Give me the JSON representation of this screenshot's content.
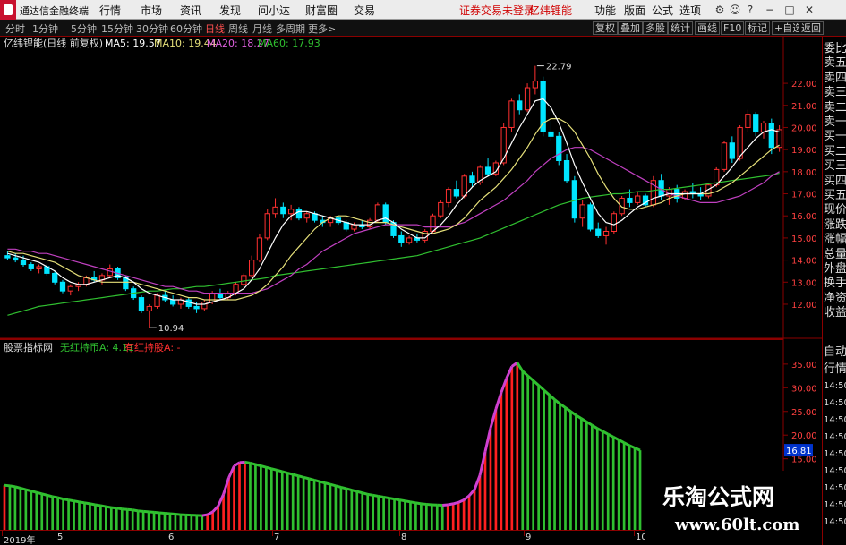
{
  "menubar": {
    "title": "通达信金融终端",
    "menu": [
      "行情",
      "市场",
      "资讯",
      "发现",
      "问小达",
      "财富圈",
      "交易"
    ],
    "notice": "证券交易未登录",
    "indicator_name": "亿纬锂能",
    "right": [
      "功能",
      "版面",
      "公式",
      "选项"
    ]
  },
  "periodbar": {
    "periods": [
      "分时",
      "1分钟",
      "5分钟",
      "15分钟",
      "30分钟",
      "60分钟",
      "日线",
      "周线",
      "月线",
      "多周期",
      "更多>"
    ],
    "active": "日线",
    "tools": [
      "复权",
      "叠加",
      "多股",
      "统计",
      "画线",
      "F10",
      "标记",
      "+自选",
      "返回"
    ]
  },
  "main_chart": {
    "title": "亿纬锂能(日线 前复权)",
    "ma5": "MA5: 19.57",
    "ma10": "MA10: 19.44",
    "ma20": "MA20: 18.27",
    "ma60": "MA60: 17.93",
    "high_label": "22.79",
    "low_label": "10.94",
    "y_labels": [
      "22.00",
      "21.00",
      "20.00",
      "19.00",
      "18.00",
      "17.00",
      "16.00",
      "15.00",
      "14.00",
      "13.00",
      "12.00"
    ]
  },
  "sub_chart": {
    "title": "股票指标网",
    "line1": "无红持币A: 4.11",
    "line2": "有红持股A: -",
    "y_labels": [
      "35.00",
      "30.00",
      "25.00",
      "20.00",
      "15.00"
    ],
    "current_value": "16.81"
  },
  "right_panel": {
    "items": [
      "委比",
      "卖五",
      "卖四",
      "卖三",
      "卖二",
      "卖一",
      "买一",
      "买二",
      "买三",
      "买四",
      "买五",
      "现价",
      "涨跌",
      "涨幅",
      "总量",
      "外盘",
      "换手",
      "净资",
      "收益"
    ],
    "sub_items": [
      "自动",
      "行情",
      "14:50",
      "14:50",
      "14:50",
      "14:50",
      "14:50",
      "14:50",
      "14:50",
      "14:50",
      "14:50"
    ]
  },
  "time_axis": {
    "labels": [
      "2019年",
      "5",
      "6",
      "7",
      "8",
      "9",
      "10"
    ]
  },
  "watermark": {
    "line1": "乐淘公式网",
    "line2": "www.60lt.com"
  },
  "colors": {
    "up": "#ff3030",
    "down": "#00e5ff",
    "ma5": "#ffffff",
    "ma10": "#e6e07a",
    "ma20": "#c040c0",
    "ma60": "#30c030",
    "grid_red": "#8b0000",
    "bar_green": "#30c030",
    "bar_red": "#ff2020",
    "bar_magenta": "#d040d0"
  },
  "chart_data": {
    "type": "candlestick",
    "ohlc": [
      [
        14.2,
        14.4,
        14.0,
        14.1
      ],
      [
        14.1,
        14.3,
        13.9,
        14.0
      ],
      [
        14.0,
        14.2,
        13.7,
        13.8
      ],
      [
        13.8,
        13.9,
        13.5,
        13.6
      ],
      [
        13.6,
        13.8,
        13.4,
        13.7
      ],
      [
        13.7,
        13.8,
        13.3,
        13.4
      ],
      [
        13.4,
        13.5,
        12.9,
        13.0
      ],
      [
        13.0,
        13.1,
        12.5,
        12.6
      ],
      [
        12.6,
        12.9,
        12.4,
        12.8
      ],
      [
        12.8,
        13.0,
        12.6,
        12.9
      ],
      [
        12.9,
        13.3,
        12.8,
        13.2
      ],
      [
        13.2,
        13.5,
        13.0,
        13.1
      ],
      [
        13.1,
        13.4,
        12.9,
        13.3
      ],
      [
        13.3,
        13.8,
        13.2,
        13.6
      ],
      [
        13.6,
        13.7,
        13.1,
        13.2
      ],
      [
        13.2,
        13.3,
        12.6,
        12.7
      ],
      [
        12.7,
        12.8,
        12.2,
        12.3
      ],
      [
        12.3,
        12.4,
        11.6,
        11.7
      ],
      [
        11.7,
        12.0,
        10.94,
        11.9
      ],
      [
        11.9,
        12.5,
        11.8,
        12.4
      ],
      [
        12.4,
        12.6,
        12.1,
        12.2
      ],
      [
        12.2,
        12.4,
        11.9,
        12.0
      ],
      [
        12.0,
        12.3,
        11.8,
        12.2
      ],
      [
        12.2,
        12.3,
        11.8,
        11.9
      ],
      [
        11.9,
        12.1,
        11.6,
        11.8
      ],
      [
        11.8,
        12.2,
        11.7,
        12.1
      ],
      [
        12.1,
        12.6,
        12.0,
        12.5
      ],
      [
        12.5,
        12.7,
        12.2,
        12.3
      ],
      [
        12.3,
        12.6,
        12.2,
        12.5
      ],
      [
        12.5,
        13.0,
        12.4,
        12.9
      ],
      [
        12.9,
        13.4,
        12.8,
        13.3
      ],
      [
        13.3,
        14.2,
        13.2,
        14.0
      ],
      [
        14.0,
        15.2,
        13.9,
        15.0
      ],
      [
        15.0,
        16.3,
        14.9,
        16.1
      ],
      [
        16.1,
        16.8,
        15.9,
        16.4
      ],
      [
        16.4,
        16.6,
        15.9,
        16.1
      ],
      [
        16.1,
        16.5,
        15.8,
        16.3
      ],
      [
        16.3,
        16.4,
        15.8,
        15.9
      ],
      [
        15.9,
        16.2,
        15.7,
        16.1
      ],
      [
        16.1,
        16.2,
        15.7,
        15.8
      ],
      [
        15.8,
        16.0,
        15.5,
        15.7
      ],
      [
        15.7,
        16.0,
        15.5,
        15.9
      ],
      [
        15.9,
        16.0,
        15.6,
        15.7
      ],
      [
        15.7,
        15.8,
        15.3,
        15.4
      ],
      [
        15.4,
        15.7,
        15.3,
        15.6
      ],
      [
        15.6,
        15.8,
        15.4,
        15.5
      ],
      [
        15.5,
        15.9,
        15.4,
        15.8
      ],
      [
        15.8,
        16.6,
        15.7,
        16.5
      ],
      [
        16.5,
        16.6,
        15.6,
        15.7
      ],
      [
        15.7,
        15.8,
        15.0,
        15.1
      ],
      [
        15.1,
        15.3,
        14.6,
        14.8
      ],
      [
        14.8,
        15.1,
        14.7,
        15.0
      ],
      [
        15.0,
        15.2,
        14.8,
        14.9
      ],
      [
        14.9,
        15.4,
        14.8,
        15.3
      ],
      [
        15.3,
        16.1,
        15.2,
        16.0
      ],
      [
        16.0,
        16.7,
        15.9,
        16.6
      ],
      [
        16.6,
        17.3,
        16.4,
        17.2
      ],
      [
        17.2,
        17.6,
        16.8,
        16.9
      ],
      [
        16.9,
        17.9,
        16.8,
        17.8
      ],
      [
        17.8,
        18.0,
        17.3,
        17.5
      ],
      [
        17.5,
        18.3,
        17.4,
        18.2
      ],
      [
        18.2,
        18.6,
        17.8,
        17.9
      ],
      [
        17.9,
        18.5,
        17.8,
        18.4
      ],
      [
        18.4,
        20.2,
        18.3,
        20.0
      ],
      [
        20.0,
        21.3,
        19.8,
        21.2
      ],
      [
        21.2,
        21.5,
        20.6,
        20.8
      ],
      [
        20.8,
        22.0,
        20.7,
        21.8
      ],
      [
        21.8,
        22.79,
        21.5,
        22.1
      ],
      [
        22.1,
        22.3,
        19.6,
        19.8
      ],
      [
        19.8,
        20.3,
        19.4,
        19.6
      ],
      [
        19.6,
        19.8,
        18.3,
        18.5
      ],
      [
        18.5,
        18.8,
        17.5,
        17.6
      ],
      [
        17.6,
        17.8,
        15.7,
        15.9
      ],
      [
        15.9,
        16.7,
        15.5,
        16.5
      ],
      [
        16.5,
        16.6,
        15.3,
        15.4
      ],
      [
        15.4,
        15.7,
        15.0,
        15.1
      ],
      [
        15.1,
        15.5,
        14.7,
        15.3
      ],
      [
        15.3,
        16.2,
        15.2,
        16.1
      ],
      [
        16.1,
        16.9,
        16.0,
        16.8
      ],
      [
        16.8,
        17.2,
        16.4,
        16.6
      ],
      [
        16.6,
        17.1,
        16.5,
        16.9
      ],
      [
        16.9,
        17.0,
        16.4,
        16.5
      ],
      [
        16.5,
        17.8,
        16.4,
        17.6
      ],
      [
        17.6,
        17.9,
        16.7,
        16.9
      ],
      [
        16.9,
        17.3,
        16.5,
        17.2
      ],
      [
        17.2,
        17.4,
        16.6,
        16.8
      ],
      [
        16.8,
        17.2,
        16.7,
        17.1
      ],
      [
        17.1,
        17.5,
        16.8,
        17.0
      ],
      [
        17.0,
        17.3,
        16.7,
        16.9
      ],
      [
        16.9,
        17.5,
        16.8,
        17.4
      ],
      [
        17.4,
        18.2,
        17.3,
        18.1
      ],
      [
        18.1,
        19.4,
        18.0,
        19.3
      ],
      [
        19.3,
        19.6,
        18.4,
        18.6
      ],
      [
        18.6,
        20.1,
        18.5,
        20.0
      ],
      [
        20.0,
        20.8,
        19.8,
        20.6
      ],
      [
        20.6,
        20.7,
        19.6,
        19.8
      ],
      [
        19.8,
        20.3,
        19.5,
        20.2
      ],
      [
        20.2,
        20.4,
        18.8,
        19.1
      ],
      [
        19.1,
        20.1,
        18.9,
        19.9
      ]
    ],
    "ma5": [
      14.3,
      14.2,
      14.1,
      14.0,
      13.9,
      13.7,
      13.5,
      13.2,
      13.0,
      12.9,
      12.9,
      13.0,
      13.1,
      13.2,
      13.3,
      13.2,
      13.0,
      12.7,
      12.5,
      12.4,
      12.3,
      12.2,
      12.2,
      12.1,
      12.0,
      12.0,
      12.1,
      12.2,
      12.3,
      12.5,
      12.7,
      13.1,
      13.6,
      14.3,
      15.0,
      15.6,
      16.0,
      16.2,
      16.2,
      16.1,
      16.0,
      15.9,
      15.8,
      15.7,
      15.6,
      15.6,
      15.6,
      15.8,
      15.9,
      15.7,
      15.4,
      15.2,
      15.0,
      15.0,
      15.3,
      15.6,
      16.0,
      16.5,
      16.9,
      17.3,
      17.6,
      17.8,
      18.0,
      18.6,
      19.3,
      20.0,
      20.6,
      21.2,
      21.3,
      20.9,
      20.2,
      19.3,
      18.3,
      17.5,
      16.8,
      16.1,
      15.7,
      15.6,
      15.8,
      16.1,
      16.4,
      16.6,
      16.8,
      16.9,
      17.0,
      17.0,
      17.0,
      17.0,
      17.0,
      17.2,
      17.4,
      17.8,
      18.2,
      18.7,
      19.1,
      19.5,
      19.8,
      19.9,
      19.8
    ],
    "ma10": [
      14.4,
      14.3,
      14.3,
      14.2,
      14.1,
      14.0,
      13.9,
      13.7,
      13.5,
      13.3,
      13.2,
      13.1,
      13.0,
      13.0,
      13.0,
      13.0,
      13.0,
      12.9,
      12.8,
      12.7,
      12.6,
      12.5,
      12.4,
      12.3,
      12.3,
      12.2,
      12.2,
      12.2,
      12.2,
      12.2,
      12.3,
      12.4,
      12.6,
      12.9,
      13.3,
      13.7,
      14.2,
      14.6,
      15.0,
      15.4,
      15.7,
      15.9,
      16.0,
      16.0,
      15.9,
      15.8,
      15.7,
      15.7,
      15.7,
      15.6,
      15.5,
      15.4,
      15.3,
      15.2,
      15.2,
      15.3,
      15.4,
      15.6,
      15.9,
      16.3,
      16.7,
      17.0,
      17.3,
      17.7,
      18.1,
      18.6,
      19.1,
      19.7,
      20.2,
      20.4,
      20.4,
      20.2,
      19.8,
      19.2,
      18.6,
      17.9,
      17.3,
      16.8,
      16.4,
      16.3,
      16.3,
      16.4,
      16.5,
      16.6,
      16.8,
      16.9,
      17.0,
      17.0,
      17.0,
      17.0,
      17.1,
      17.3,
      17.5,
      17.8,
      18.1,
      18.4,
      18.7,
      19.0,
      19.2
    ],
    "ma20": [
      14.5,
      14.5,
      14.4,
      14.4,
      14.3,
      14.3,
      14.2,
      14.1,
      14.0,
      13.9,
      13.8,
      13.7,
      13.6,
      13.5,
      13.4,
      13.3,
      13.2,
      13.1,
      13.0,
      12.9,
      12.8,
      12.8,
      12.7,
      12.6,
      12.6,
      12.5,
      12.5,
      12.5,
      12.5,
      12.5,
      12.5,
      12.5,
      12.6,
      12.7,
      12.9,
      13.1,
      13.3,
      13.6,
      13.8,
      14.1,
      14.4,
      14.6,
      14.8,
      15.0,
      15.2,
      15.3,
      15.4,
      15.5,
      15.6,
      15.6,
      15.6,
      15.6,
      15.6,
      15.5,
      15.5,
      15.5,
      15.5,
      15.6,
      15.7,
      15.9,
      16.1,
      16.3,
      16.5,
      16.7,
      17.0,
      17.3,
      17.6,
      18.0,
      18.3,
      18.6,
      18.8,
      19.0,
      19.1,
      19.1,
      19.0,
      18.8,
      18.6,
      18.4,
      18.2,
      18.0,
      17.8,
      17.6,
      17.4,
      17.2,
      17.0,
      16.9,
      16.8,
      16.7,
      16.6,
      16.6,
      16.6,
      16.7,
      16.8,
      16.9,
      17.1,
      17.3,
      17.5,
      17.8,
      18.0
    ],
    "ma60": [
      11.5,
      11.6,
      11.7,
      11.8,
      11.9,
      11.95,
      12.0,
      12.05,
      12.1,
      12.15,
      12.2,
      12.25,
      12.3,
      12.35,
      12.4,
      12.45,
      12.5,
      12.55,
      12.6,
      12.6,
      12.65,
      12.7,
      12.7,
      12.75,
      12.8,
      12.8,
      12.85,
      12.9,
      12.95,
      13.0,
      13.05,
      13.1,
      13.15,
      13.2,
      13.3,
      13.35,
      13.4,
      13.45,
      13.5,
      13.55,
      13.6,
      13.65,
      13.7,
      13.75,
      13.8,
      13.85,
      13.9,
      13.95,
      14.0,
      14.05,
      14.1,
      14.15,
      14.2,
      14.3,
      14.4,
      14.5,
      14.6,
      14.7,
      14.8,
      14.9,
      15.0,
      15.15,
      15.3,
      15.45,
      15.6,
      15.75,
      15.9,
      16.05,
      16.2,
      16.35,
      16.5,
      16.6,
      16.7,
      16.8,
      16.85,
      16.9,
      16.95,
      17.0,
      17.0,
      17.05,
      17.1,
      17.1,
      17.15,
      17.2,
      17.2,
      17.25,
      17.3,
      17.35,
      17.4,
      17.45,
      17.5,
      17.55,
      17.6,
      17.65,
      17.7,
      17.75,
      17.8,
      17.85,
      17.93
    ],
    "indicator_values": [
      9.4,
      9.3,
      9.1,
      8.8,
      8.5,
      8.2,
      7.9,
      7.6,
      7.3,
      7.0,
      6.8,
      6.5,
      6.3,
      6.1,
      5.9,
      5.7,
      5.5,
      5.3,
      5.1,
      4.9,
      4.7,
      4.6,
      4.4,
      4.3,
      4.2,
      4.0,
      3.9,
      3.8,
      3.7,
      3.6,
      3.5,
      3.4,
      3.3,
      3.2,
      3.15,
      3.1,
      3.05,
      3.0,
      3.2,
      3.8,
      5.0,
      7.5,
      11.0,
      13.5,
      14.2,
      14.3,
      14.1,
      13.8,
      13.5,
      13.2,
      12.9,
      12.6,
      12.3,
      12.0,
      11.7,
      11.4,
      11.1,
      10.8,
      10.5,
      10.2,
      9.9,
      9.6,
      9.3,
      9.0,
      8.7,
      8.4,
      8.1,
      7.8,
      7.5,
      7.3,
      7.1,
      6.9,
      6.7,
      6.5,
      6.3,
      6.1,
      5.9,
      5.7,
      5.5,
      5.4,
      5.3,
      5.25,
      5.2,
      5.3,
      5.5,
      5.8,
      6.3,
      7.2,
      8.5,
      11.5,
      16.5,
      21.5,
      25.5,
      29.0,
      32.0,
      34.5,
      35.3,
      33.5,
      32.5,
      31.5,
      30.5,
      29.5,
      28.5,
      27.5,
      26.6,
      25.8,
      25.0,
      24.2,
      23.5,
      22.8,
      22.1,
      21.4,
      20.8,
      20.2,
      19.6,
      19.0,
      18.4,
      17.8,
      17.3,
      16.81
    ]
  }
}
